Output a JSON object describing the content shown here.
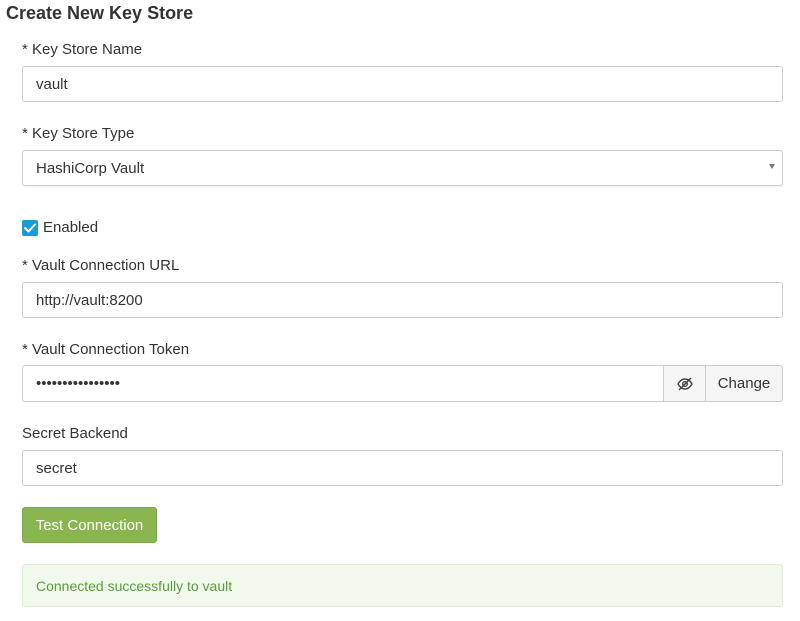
{
  "page": {
    "title": "Create New Key Store"
  },
  "form": {
    "name": {
      "label": "* Key Store Name",
      "value": "vault"
    },
    "type": {
      "label": "* Key Store Type",
      "selected": "HashiCorp Vault"
    },
    "enabled": {
      "label": "Enabled",
      "checked": true
    },
    "url": {
      "label": "* Vault Connection URL",
      "value": "http://vault:8200"
    },
    "token": {
      "label": "* Vault Connection Token",
      "value": "••••••••••••••••",
      "change_label": "Change"
    },
    "backend": {
      "label": "Secret Backend",
      "value": "secret"
    },
    "test_button_label": "Test Connection"
  },
  "alert": {
    "message": "Connected successfully to vault"
  },
  "colors": {
    "primary_checkbox": "#1a9bd7",
    "success_button": "#8ab64f",
    "success_alert_bg": "#f0f9ec",
    "success_alert_text": "#5a9a3f"
  },
  "icons": {
    "checkbox": "checkmark-icon",
    "token_visibility": "eye-slash-icon",
    "select": "caret-down-icon"
  }
}
